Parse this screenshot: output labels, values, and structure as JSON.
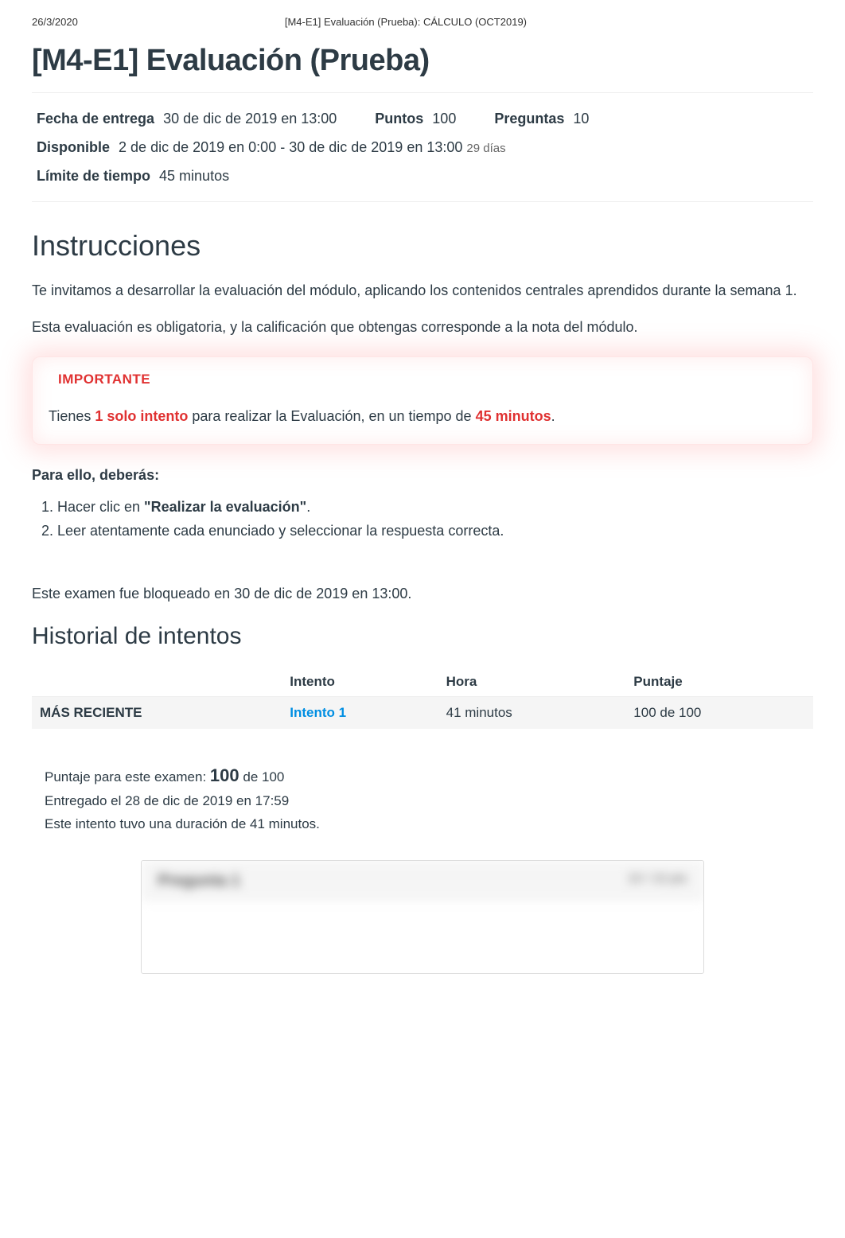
{
  "meta": {
    "date": "26/3/2020",
    "doc_title": "[M4-E1] Evaluación (Prueba): CÁLCULO (OCT2019)"
  },
  "title": "[M4-E1] Evaluación (Prueba)",
  "info": {
    "due_label": "Fecha de entrega",
    "due_value": "30 de dic de 2019 en 13:00",
    "points_label": "Puntos",
    "points_value": "100",
    "questions_label": "Preguntas",
    "questions_value": "10",
    "available_label": "Disponible",
    "available_value": "2 de dic de 2019 en 0:00 - 30 de dic de 2019 en 13:00",
    "available_days": "29 días",
    "timelimit_label": "Límite de tiempo",
    "timelimit_value": "45 minutos"
  },
  "instructions": {
    "heading": "Instrucciones",
    "p1": "Te invitamos a desarrollar la evaluación del módulo, aplicando los contenidos centrales aprendidos durante la semana 1.",
    "p2": "Esta evaluación es obligatoria, y la calificación que obtengas corresponde a la nota del módulo."
  },
  "important": {
    "label": "IMPORTANTE",
    "pre1": "Tienes ",
    "red1": "1 solo intento",
    "mid": " para realizar la Evaluación, en un tiempo de ",
    "red2": "45 minutos",
    "post": "."
  },
  "steps": {
    "heading": "Para ello, deberás:",
    "s1a": "Hacer clic en ",
    "s1b": "\"Realizar la evaluación\"",
    "s1c": ".",
    "s2": "Leer atentamente cada enunciado y seleccionar la respuesta correcta."
  },
  "locked_text": "Este examen fue bloqueado en 30 de dic de 2019 en 13:00.",
  "history": {
    "heading": "Historial de intentos",
    "th_attempt": "Intento",
    "th_time": "Hora",
    "th_score": "Puntaje",
    "row": {
      "label": "MÁS RECIENTE",
      "attempt": "Intento 1",
      "time": "41 minutos",
      "score": "100 de 100"
    }
  },
  "score": {
    "line1a": "Puntaje para este examen: ",
    "line1b": "100",
    "line1c": " de 100",
    "line2": "Entregado el 28 de dic de 2019 en 17:59",
    "line3": "Este intento tuvo una duración de 41 minutos."
  },
  "question_preview": {
    "left": "Pregunta 1",
    "right": "10 / 10 pts"
  }
}
